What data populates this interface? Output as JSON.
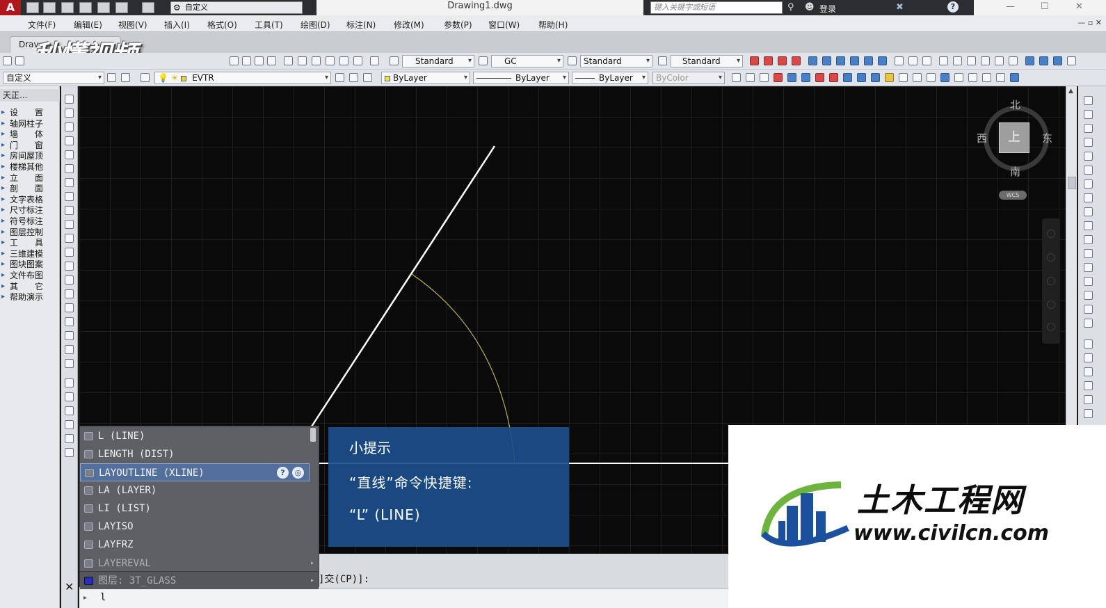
{
  "titlebar": {
    "app_letter": "A",
    "workspace": "自定义",
    "doc_title": "Drawing1.dwg",
    "search_placeholder": "键入关键字或短语",
    "login": "登录",
    "help": "?"
  },
  "menu": [
    "文件(F)",
    "编辑(E)",
    "视图(V)",
    "插入(I)",
    "格式(O)",
    "工具(T)",
    "绘图(D)",
    "标注(N)",
    "修改(M)",
    "参数(P)",
    "窗口(W)",
    "帮助(H)"
  ],
  "tabs": {
    "doc_tab": "Drav"
  },
  "watermark": "秒懂视频",
  "toolbar1": {
    "text_style": "Standard",
    "dim_style": "GC",
    "table_style": "Standard",
    "multileader_style": "Standard"
  },
  "toolbar2": {
    "workspace2": "自定义",
    "layer": "EVTR",
    "color": "ByLayer",
    "linetype": "ByLayer",
    "lineweight": "ByLayer",
    "plotstyle": "ByColor"
  },
  "tz_panel": {
    "title": "天正...",
    "items": [
      "设　　置",
      "轴网柱子",
      "墙　　体",
      "门　　窗",
      "房间屋顶",
      "楼梯其他",
      "立　　面",
      "剖　　面",
      "文字表格",
      "尺寸标注",
      "符号标注",
      "图层控制",
      "工　　具",
      "三维建模",
      "图块图案",
      "文件布图",
      "其　　它",
      "帮助演示"
    ]
  },
  "viewcube": {
    "north": "北",
    "south": "南",
    "west": "西",
    "east": "东",
    "face": "上",
    "wcs": "WCS"
  },
  "autocomplete": {
    "items": [
      {
        "label": "L (LINE)",
        "state": "normal"
      },
      {
        "label": "LENGTH (DIST)",
        "state": "normal"
      },
      {
        "label": "LAYOUTLINE (XLINE)",
        "state": "selected"
      },
      {
        "label": "LA (LAYER)",
        "state": "normal"
      },
      {
        "label": "LI (LIST)",
        "state": "normal"
      },
      {
        "label": "LAYISO",
        "state": "normal"
      },
      {
        "label": "LAYFRZ",
        "state": "normal"
      },
      {
        "label": "LAYEREVAL",
        "state": "dim"
      },
      {
        "label": "图层: 3T_GLASS",
        "state": "layer"
      }
    ]
  },
  "tip": {
    "title": "小提示",
    "line1": "“直线”命令快捷键:",
    "line2": "“L” (LINE)"
  },
  "command": {
    "prompt_fragment": "]交(CP)]:",
    "input": "l"
  },
  "logo_card": {
    "name": "土木工程网",
    "url": "www.civilcn.com",
    "colors": {
      "blue": "#1c4f9c",
      "green": "#6cb33f"
    }
  }
}
